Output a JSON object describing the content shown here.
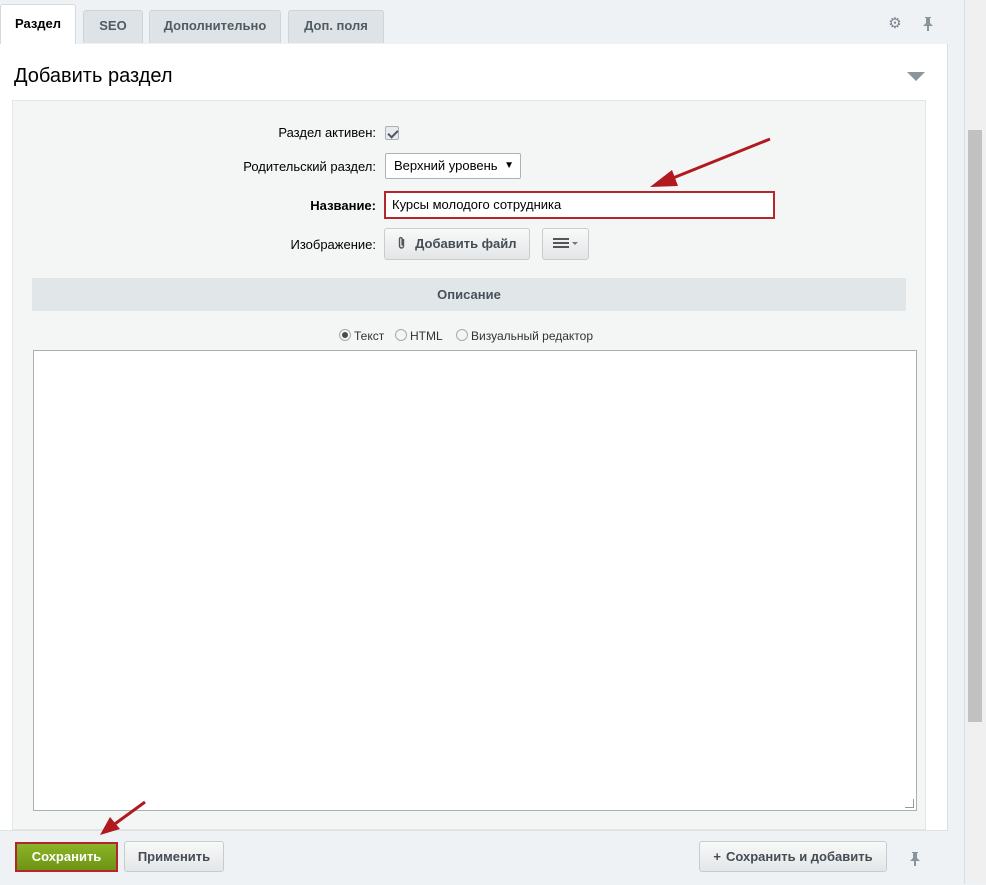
{
  "tabs": [
    {
      "label": "Раздел",
      "active": true
    },
    {
      "label": "SEO",
      "active": false
    },
    {
      "label": "Дополнительно",
      "active": false
    },
    {
      "label": "Доп. поля",
      "active": false
    }
  ],
  "tabbar_icons": [
    "gear-icon",
    "pin-icon"
  ],
  "form": {
    "title": "Добавить раздел",
    "active_label": "Раздел активен:",
    "active_checked": true,
    "parent_label": "Родительский раздел:",
    "parent_value": "Верхний уровень",
    "name_label": "Название:",
    "name_value": "Курсы молодого сотрудника",
    "image_label": "Изображение:",
    "add_file_label": "Добавить файл",
    "description_header": "Описание",
    "modes": [
      {
        "label": "Текст",
        "selected": true
      },
      {
        "label": "HTML",
        "selected": false
      },
      {
        "label": "Визуальный редактор",
        "selected": false
      }
    ],
    "description_value": ""
  },
  "footer": {
    "save_label": "Сохранить",
    "apply_label": "Применить",
    "save_add_label": "Сохранить и добавить"
  },
  "colors": {
    "accent_red": "#b4262d",
    "save_green": "#7aa31b"
  }
}
